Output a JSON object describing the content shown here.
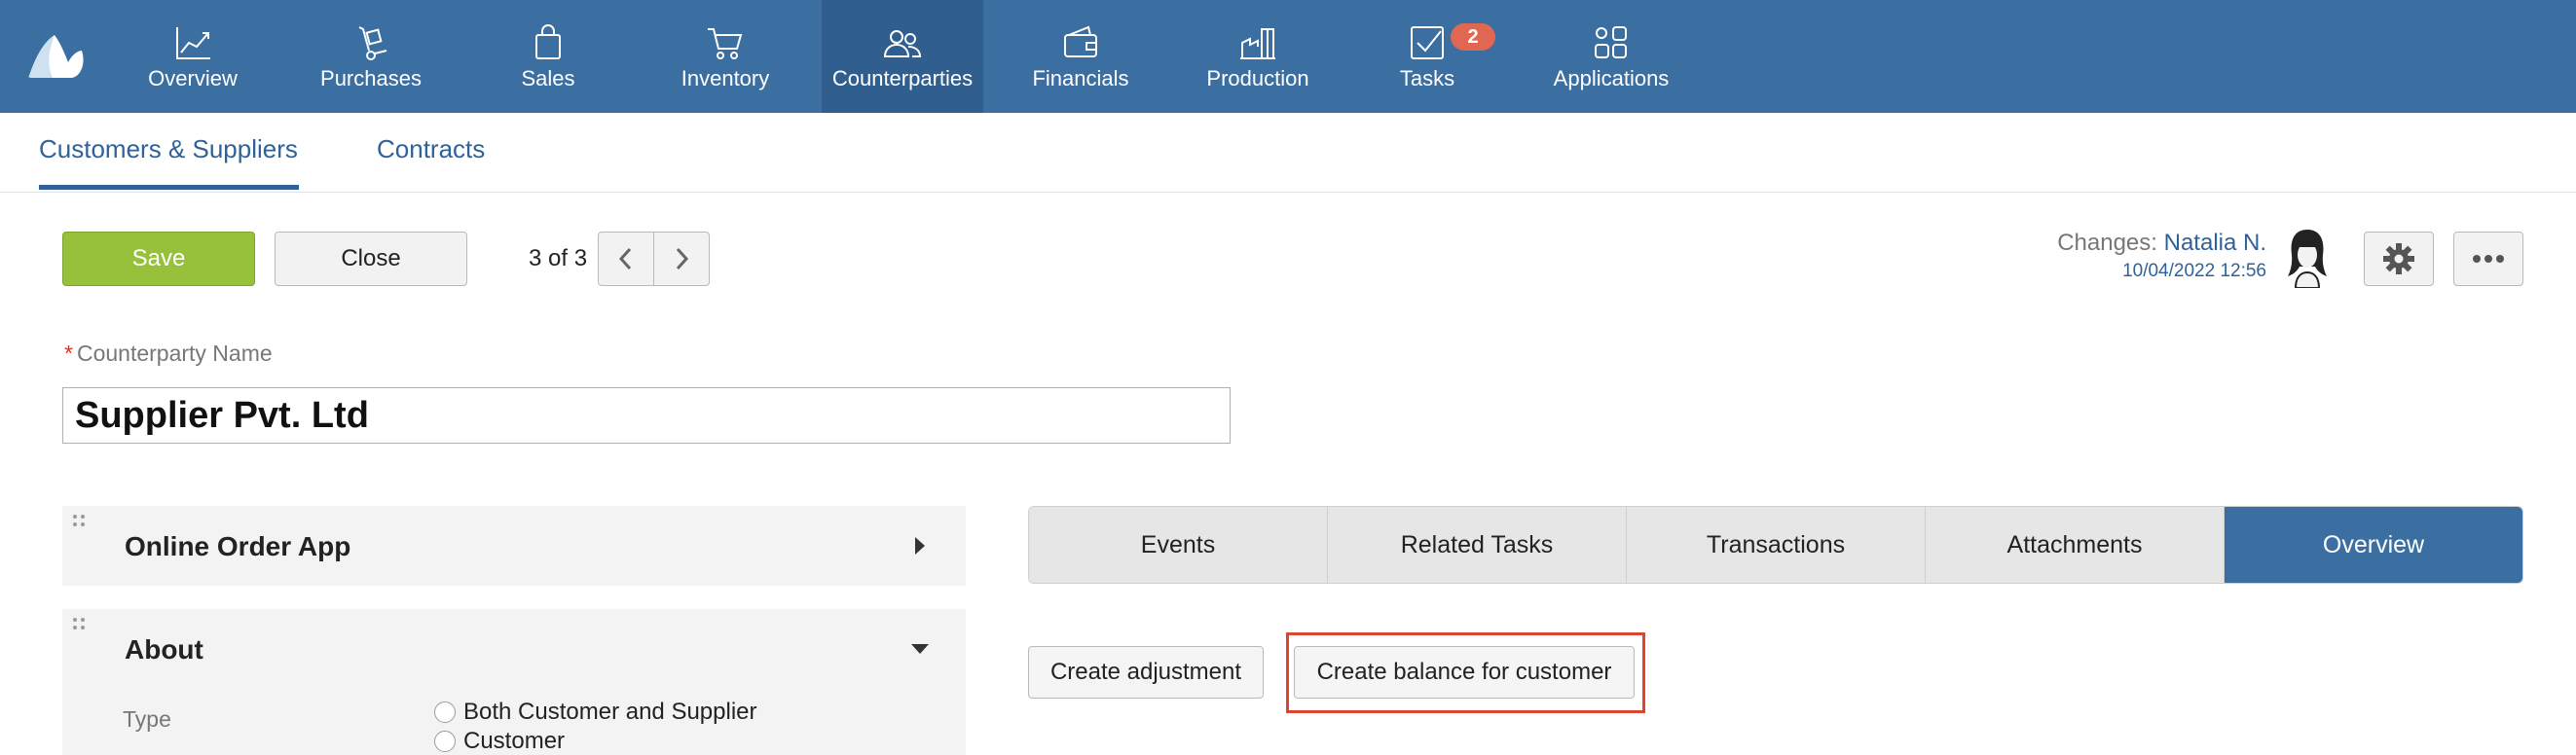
{
  "nav": {
    "items": [
      {
        "label": "Overview"
      },
      {
        "label": "Purchases"
      },
      {
        "label": "Sales"
      },
      {
        "label": "Inventory"
      },
      {
        "label": "Counterparties"
      },
      {
        "label": "Financials"
      },
      {
        "label": "Production"
      },
      {
        "label": "Tasks"
      },
      {
        "label": "Applications"
      }
    ],
    "active": "Counterparties",
    "tasks_badge": "2"
  },
  "subnav": {
    "tabs": [
      {
        "label": "Customers & Suppliers"
      },
      {
        "label": "Contracts"
      }
    ],
    "active": "Customers & Suppliers"
  },
  "toolbar": {
    "save_label": "Save",
    "close_label": "Close",
    "pager_text": "3 of 3"
  },
  "changes": {
    "label": "Changes:",
    "user": "Natalia N.",
    "timestamp": "10/04/2022 12:56"
  },
  "form": {
    "required_mark": "*",
    "name_label": "Counterparty Name",
    "name_value": "Supplier Pvt. Ltd"
  },
  "panels": {
    "online_order": {
      "title": "Online Order App"
    },
    "about": {
      "title": "About",
      "type_label": "Type",
      "type_options": [
        "Both Customer and Supplier",
        "Customer"
      ]
    }
  },
  "right_tabs": {
    "items": [
      {
        "label": "Events"
      },
      {
        "label": "Related Tasks"
      },
      {
        "label": "Transactions"
      },
      {
        "label": "Attachments"
      },
      {
        "label": "Overview"
      }
    ],
    "active": "Overview"
  },
  "actions": {
    "create_adjustment": "Create adjustment",
    "create_balance": "Create balance for customer"
  },
  "colors": {
    "nav_bg": "#3b6ea1",
    "nav_active": "#2f5e8f",
    "save_green": "#98c13b",
    "link_blue": "#2f6299",
    "badge": "#e06752",
    "highlight": "#e0432e"
  }
}
